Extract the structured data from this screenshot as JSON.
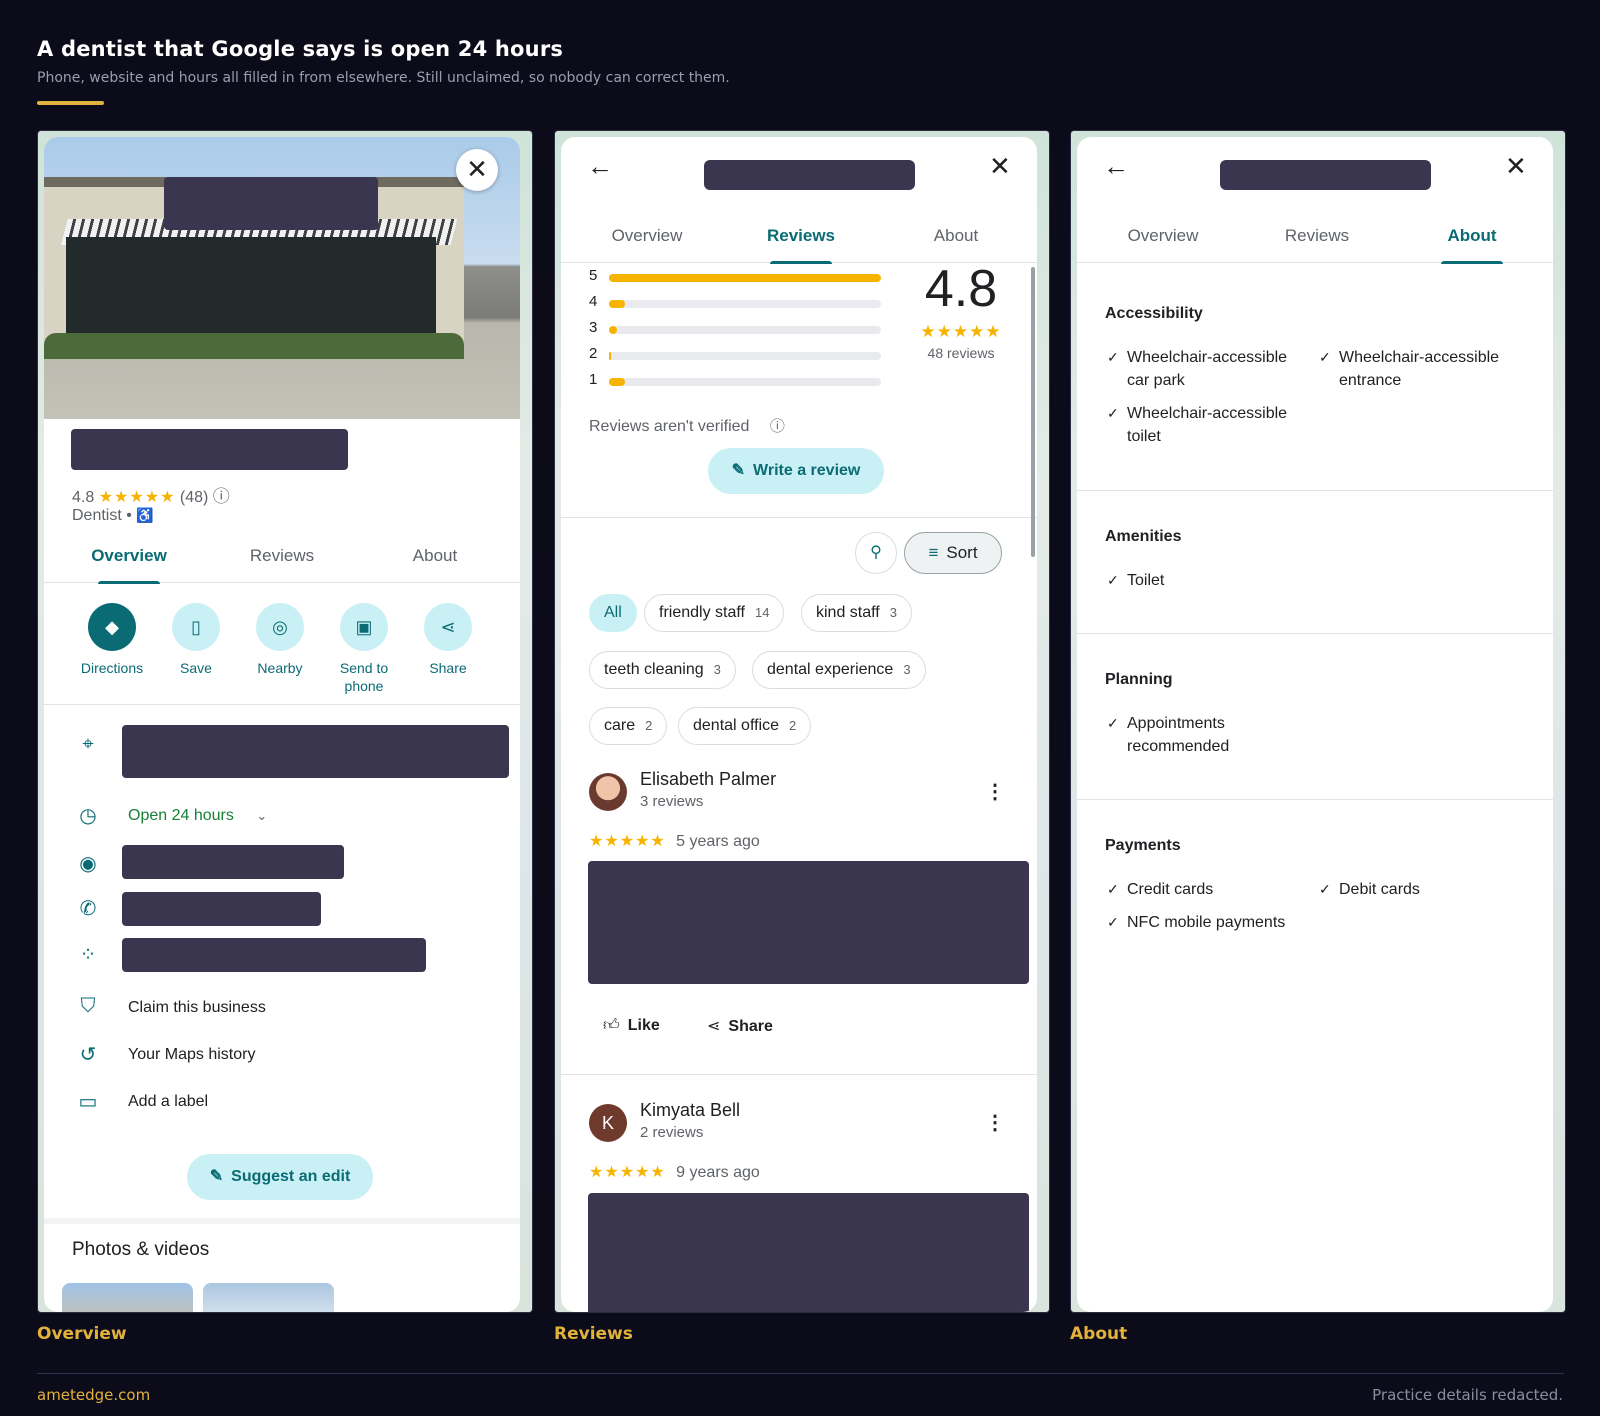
{
  "header": {
    "title": "A dentist that Google says is open 24 hours",
    "subtitle": "Phone, website and hours all filled in from elsewhere. Still unclaimed, so nobody can correct them."
  },
  "tabs": [
    "Overview",
    "Reviews",
    "About"
  ],
  "captions": [
    "Overview",
    "Reviews",
    "About"
  ],
  "overview": {
    "rating": "4.8",
    "stars": "★★★★★",
    "review_count": "(48)",
    "info_icon": "ⓘ",
    "category": "Dentist",
    "accessible_icon": "♿",
    "actions": [
      {
        "label": "Directions",
        "icon": "directions-icon"
      },
      {
        "label": "Save",
        "icon": "bookmark-icon"
      },
      {
        "label": "Nearby",
        "icon": "nearby-icon"
      },
      {
        "label": "Send to phone",
        "icon": "send-to-phone-icon"
      },
      {
        "label": "Share",
        "icon": "share-icon"
      }
    ],
    "hours": "Open 24 hours",
    "claim": "Claim this business",
    "history": "Your Maps history",
    "label": "Add a label",
    "suggest_edit": "Suggest an edit",
    "photos_title": "Photos & videos"
  },
  "reviews": {
    "distribution": [
      {
        "star": "5",
        "fraction": 1.0
      },
      {
        "star": "4",
        "fraction": 0.06
      },
      {
        "star": "3",
        "fraction": 0.03
      },
      {
        "star": "2",
        "fraction": 0.0
      },
      {
        "star": "1",
        "fraction": 0.06
      }
    ],
    "rating": "4.8",
    "stars": "★★★★★",
    "total": "48 reviews",
    "not_verified": "Reviews aren't verified",
    "write_review": "Write a review",
    "sort": "Sort",
    "chips": [
      {
        "label": "All",
        "count": ""
      },
      {
        "label": "friendly staff",
        "count": "14"
      },
      {
        "label": "kind staff",
        "count": "3"
      },
      {
        "label": "teeth cleaning",
        "count": "3"
      },
      {
        "label": "dental experience",
        "count": "3"
      },
      {
        "label": "care",
        "count": "2"
      },
      {
        "label": "dental office",
        "count": "2"
      }
    ],
    "items": [
      {
        "name": "Elisabeth Palmer",
        "sub": "3 reviews",
        "stars": "★★★★★",
        "when": "5 years ago",
        "initial": ""
      },
      {
        "name": "Kimyata Bell",
        "sub": "2 reviews",
        "stars": "★★★★★",
        "when": "9 years ago",
        "initial": "K"
      }
    ],
    "like": "Like",
    "share": "Share"
  },
  "about": {
    "sections": [
      {
        "title": "Accessibility",
        "items": [
          "Wheelchair-accessible car park",
          "Wheelchair-accessible entrance",
          "Wheelchair-accessible toilet"
        ]
      },
      {
        "title": "Amenities",
        "items": [
          "Toilet"
        ]
      },
      {
        "title": "Planning",
        "items": [
          "Appointments recommended"
        ]
      },
      {
        "title": "Payments",
        "items": [
          "Credit cards",
          "Debit cards",
          "NFC mobile payments"
        ]
      }
    ]
  },
  "footer": {
    "left": "ametedge.com",
    "right": "Practice details redacted."
  },
  "colors": {
    "accent": "#0b6b74",
    "star": "#f6b400",
    "open": "#188038",
    "caption": "#e3b23c",
    "redaction": "#3b3650"
  }
}
